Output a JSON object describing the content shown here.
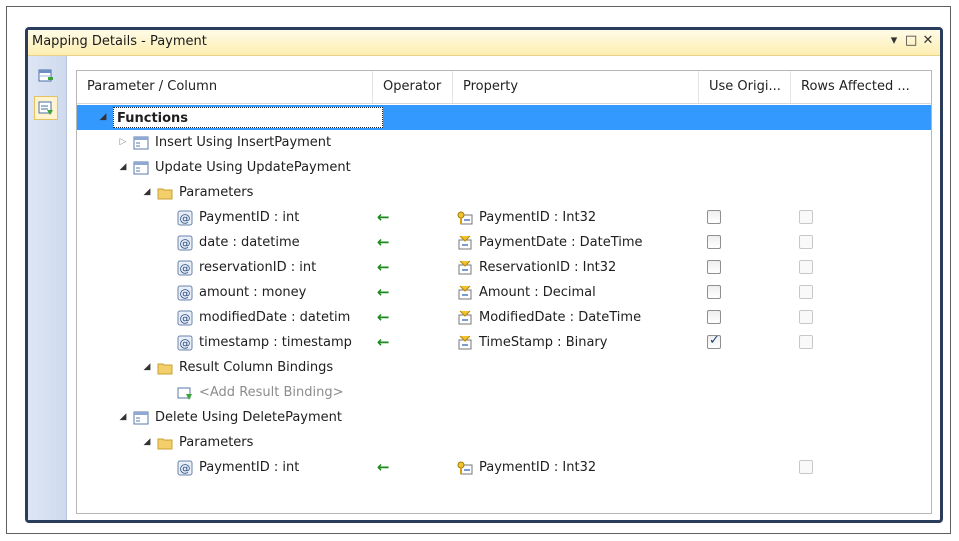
{
  "window": {
    "title": "Mapping Details - Payment",
    "controls": {
      "dropdown": "▾",
      "maximize": "□",
      "close": "✕"
    }
  },
  "toolbar": {
    "buttons": [
      {
        "icon": "map-to-table-icon"
      },
      {
        "icon": "map-to-functions-icon",
        "active": true
      }
    ]
  },
  "grid": {
    "columns": {
      "param": "Parameter / Column",
      "operator": "Operator",
      "property": "Property",
      "use_original": "Use Origi...",
      "rows_affected": "Rows Affected ..."
    },
    "rows": [
      {
        "label": "Functions",
        "type": "root",
        "expanded": true,
        "selected": true
      },
      {
        "label": "Insert Using InsertPayment",
        "type": "function",
        "expanded": false
      },
      {
        "label": "Update Using UpdatePayment",
        "type": "function",
        "expanded": true
      },
      {
        "label": "Parameters",
        "type": "folder",
        "expanded": true
      },
      {
        "label": "PaymentID : int",
        "type": "param",
        "operator": "←",
        "property": "PaymentID : Int32",
        "prop_icon": "key-property-icon",
        "use_original": false,
        "rows_affected": false
      },
      {
        "label": "date : datetime",
        "type": "param",
        "operator": "←",
        "property": "PaymentDate : DateTime",
        "prop_icon": "property-icon",
        "use_original": false,
        "rows_affected": false
      },
      {
        "label": "reservationID : int",
        "type": "param",
        "operator": "←",
        "property": "ReservationID : Int32",
        "prop_icon": "property-icon",
        "use_original": false,
        "rows_affected": false
      },
      {
        "label": "amount : money",
        "type": "param",
        "operator": "←",
        "property": "Amount : Decimal",
        "prop_icon": "property-icon",
        "use_original": false,
        "rows_affected": false
      },
      {
        "label": "modifiedDate : datetim",
        "type": "param",
        "operator": "←",
        "property": "ModifiedDate : DateTime",
        "prop_icon": "property-icon",
        "use_original": false,
        "rows_affected": false
      },
      {
        "label": "timestamp : timestamp",
        "type": "param",
        "operator": "←",
        "property": "TimeStamp : Binary",
        "prop_icon": "property-icon",
        "use_original": true,
        "rows_affected": false
      },
      {
        "label": "Result Column Bindings",
        "type": "folder",
        "expanded": true
      },
      {
        "label": "<Add Result Binding>",
        "type": "add"
      },
      {
        "label": "Delete Using DeletePayment",
        "type": "function",
        "expanded": true
      },
      {
        "label": "Parameters",
        "type": "folder",
        "expanded": true
      },
      {
        "label": "PaymentID : int",
        "type": "param",
        "operator": "←",
        "property": "PaymentID : Int32",
        "prop_icon": "key-property-icon",
        "rows_affected": false
      }
    ]
  },
  "colors": {
    "selection": "#3399ff",
    "frame": "#2b3d5c",
    "titlebar": "#fdeeb0",
    "arrow": "#1d8a1d"
  }
}
